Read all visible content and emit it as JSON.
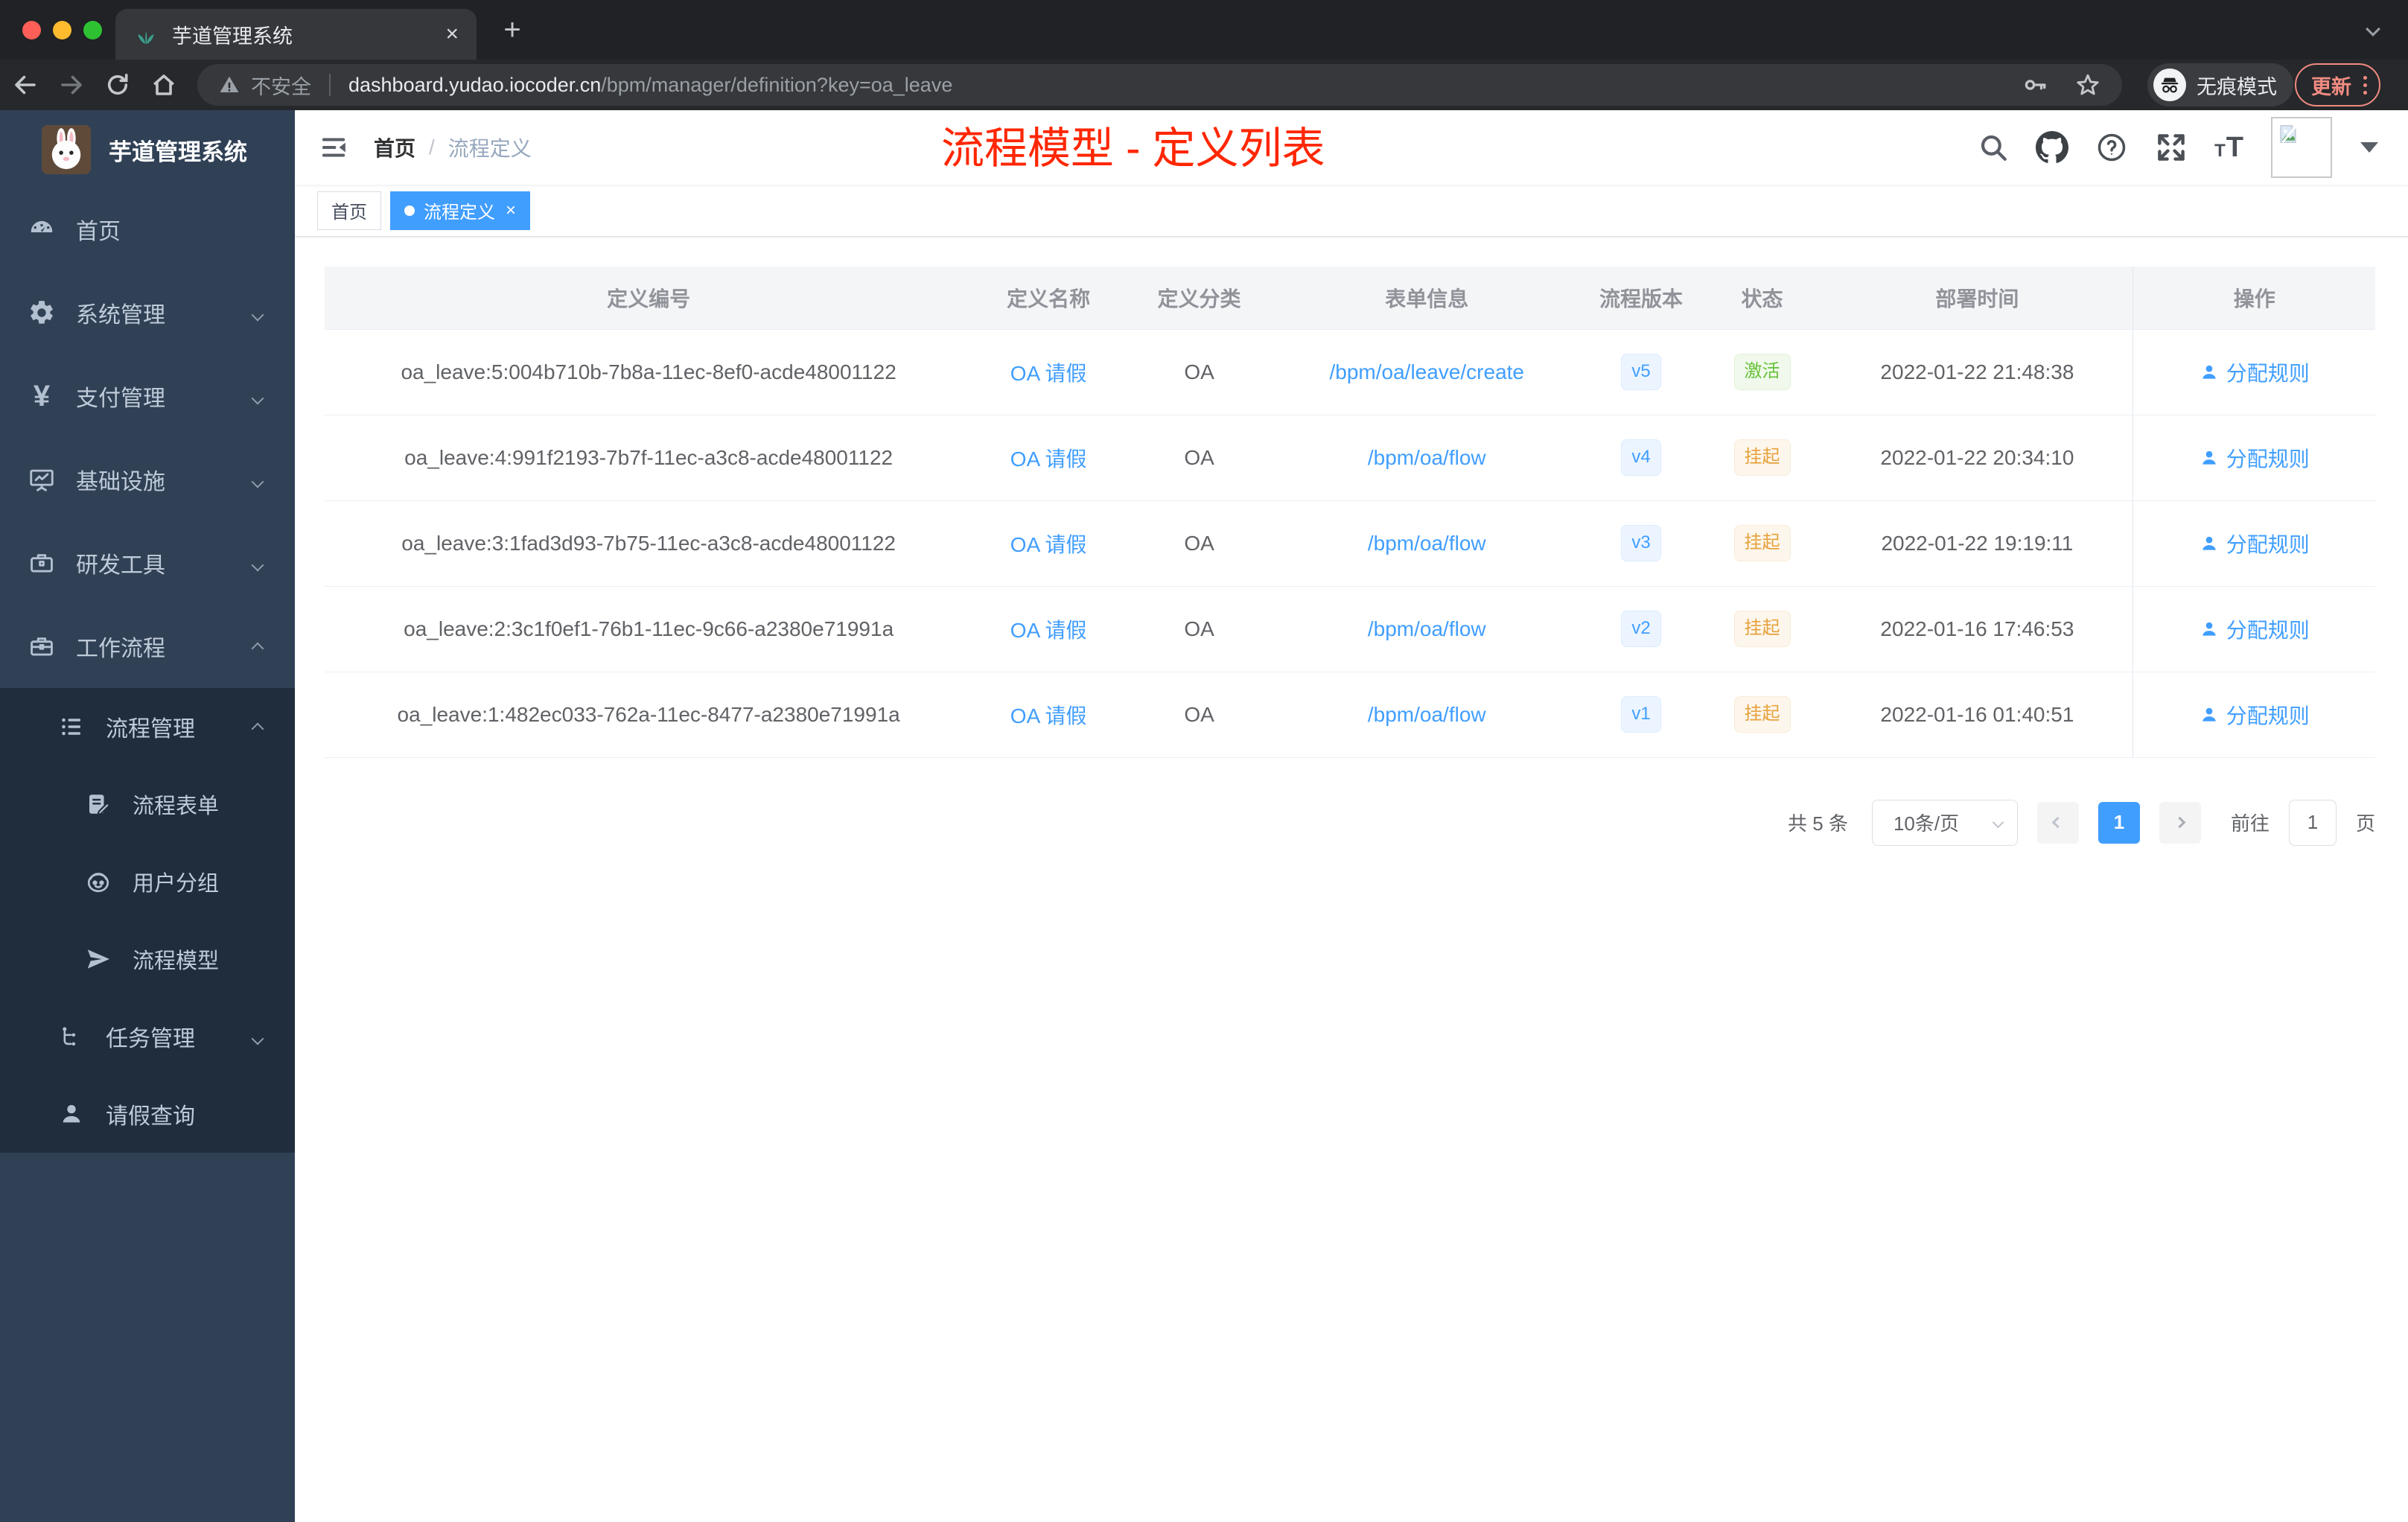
{
  "browser": {
    "tab_title": "芋道管理系统",
    "close_glyph": "×",
    "new_tab_glyph": "+",
    "not_secure_label": "不安全",
    "url_host": "dashboard.yudao.iocoder.cn",
    "url_path": "/bpm/manager/definition?key=oa_leave",
    "incognito_label": "无痕模式",
    "update_label": "更新"
  },
  "sidebar": {
    "app_title": "芋道管理系统",
    "items": [
      {
        "label": "首页"
      },
      {
        "label": "系统管理"
      },
      {
        "label": "支付管理"
      },
      {
        "label": "基础设施"
      },
      {
        "label": "研发工具"
      },
      {
        "label": "工作流程"
      }
    ],
    "sub": [
      "流程管理",
      "流程表单",
      "用户分组",
      "流程模型",
      "任务管理",
      "请假查询"
    ]
  },
  "navbar": {
    "breadcrumb_home": "首页",
    "breadcrumb_sep": "/",
    "breadcrumb_current": "流程定义",
    "annotation_title": "流程模型 - 定义列表"
  },
  "tags": {
    "home": "首页",
    "active": "流程定义",
    "active_close": "×"
  },
  "table": {
    "columns": [
      "定义编号",
      "定义名称",
      "定义分类",
      "表单信息",
      "流程版本",
      "状态",
      "部署时间",
      "操作"
    ],
    "rows": [
      {
        "id": "oa_leave:5:004b710b-7b8a-11ec-8ef0-acde48001122",
        "name": "OA 请假",
        "category": "OA",
        "form": "/bpm/oa/leave/create",
        "version": "v5",
        "status": "激活",
        "time": "2022-01-22 21:48:38",
        "action": "分配规则"
      },
      {
        "id": "oa_leave:4:991f2193-7b7f-11ec-a3c8-acde48001122",
        "name": "OA 请假",
        "category": "OA",
        "form": "/bpm/oa/flow",
        "version": "v4",
        "status": "挂起",
        "time": "2022-01-22 20:34:10",
        "action": "分配规则"
      },
      {
        "id": "oa_leave:3:1fad3d93-7b75-11ec-a3c8-acde48001122",
        "name": "OA 请假",
        "category": "OA",
        "form": "/bpm/oa/flow",
        "version": "v3",
        "status": "挂起",
        "time": "2022-01-22 19:19:11",
        "action": "分配规则"
      },
      {
        "id": "oa_leave:2:3c1f0ef1-76b1-11ec-9c66-a2380e71991a",
        "name": "OA 请假",
        "category": "OA",
        "form": "/bpm/oa/flow",
        "version": "v2",
        "status": "挂起",
        "time": "2022-01-16 17:46:53",
        "action": "分配规则"
      },
      {
        "id": "oa_leave:1:482ec033-762a-11ec-8477-a2380e71991a",
        "name": "OA 请假",
        "category": "OA",
        "form": "/bpm/oa/flow",
        "version": "v1",
        "status": "挂起",
        "time": "2022-01-16 01:40:51",
        "action": "分配规则"
      }
    ]
  },
  "pagination": {
    "total": "共 5 条",
    "page_size": "10条/页",
    "page": "1",
    "goto_label": "前往",
    "goto_value": "1",
    "unit": "页"
  },
  "colors": {
    "accent": "#409eff",
    "success": "#67c23a",
    "warning": "#e6a23c",
    "annotation_red": "#ff2600",
    "sidebar_bg": "#304156",
    "sidebar_sub_bg": "#1f2d3d"
  }
}
